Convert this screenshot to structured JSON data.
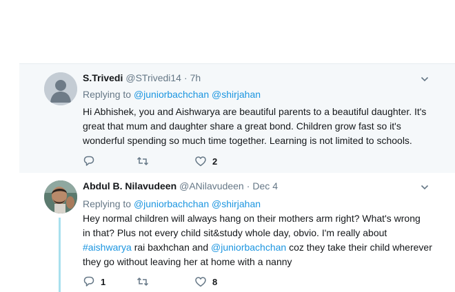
{
  "tweets": [
    {
      "name": "S.Trivedi",
      "handle": "@STrivedi14",
      "separator": "·",
      "time": "7h",
      "replying_prefix": "Replying to",
      "replying_to": [
        "@juniorbachchan",
        "@shirjahan"
      ],
      "body_lines": [
        "Hi Abhishek, you and Aishwarya are beautiful parents to a beautiful daughter. It's",
        "great that mum and daughter share a great bond. Children grow fast so it's",
        "wonderful spending so much time together. Learning  is not limited to schools."
      ],
      "reply_count": "",
      "retweet_count": "",
      "like_count": "2",
      "avatar": "default-avatar-icon"
    },
    {
      "name": "Abdul B. Nilavudeen",
      "handle": "@ANilavudeen",
      "separator": "·",
      "time": "Dec 4",
      "replying_prefix": "Replying to",
      "replying_to": [
        "@juniorbachchan",
        "@shirjahan"
      ],
      "body": {
        "line1": "Hey normal children will always hang on their mothers arm right? What's wrong",
        "line2": "in that? Plus not every child sit&study whole day, obvio. I'm really about",
        "hashtag": "#aishwarya",
        "line3_mid": " rai baxhchan and ",
        "mention": "@juniorbachchan",
        "line3_end": " coz they take their child wherever",
        "line4": "they go without leaving her at home with a nanny"
      },
      "reply_count": "1",
      "retweet_count": "",
      "like_count": "8",
      "avatar": "user-photo-avatar"
    }
  ],
  "colors": {
    "link": "#1b95e0",
    "muted": "#657786",
    "highlight_bg": "#f5f8fa",
    "thread_line": "#a8e0ee"
  }
}
